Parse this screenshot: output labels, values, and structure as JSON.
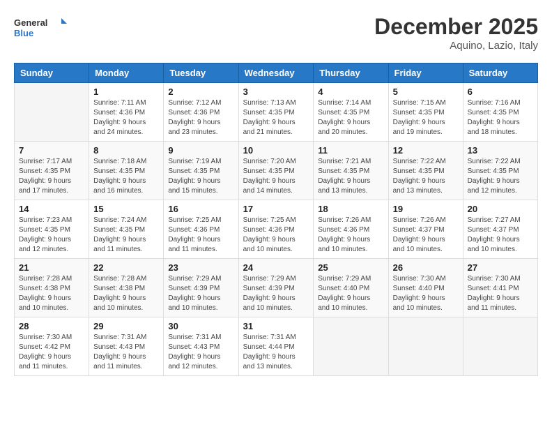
{
  "header": {
    "logo_general": "General",
    "logo_blue": "Blue",
    "month_title": "December 2025",
    "location": "Aquino, Lazio, Italy"
  },
  "days_of_week": [
    "Sunday",
    "Monday",
    "Tuesday",
    "Wednesday",
    "Thursday",
    "Friday",
    "Saturday"
  ],
  "weeks": [
    [
      {
        "day": "",
        "info": ""
      },
      {
        "day": "1",
        "info": "Sunrise: 7:11 AM\nSunset: 4:36 PM\nDaylight: 9 hours\nand 24 minutes."
      },
      {
        "day": "2",
        "info": "Sunrise: 7:12 AM\nSunset: 4:36 PM\nDaylight: 9 hours\nand 23 minutes."
      },
      {
        "day": "3",
        "info": "Sunrise: 7:13 AM\nSunset: 4:35 PM\nDaylight: 9 hours\nand 21 minutes."
      },
      {
        "day": "4",
        "info": "Sunrise: 7:14 AM\nSunset: 4:35 PM\nDaylight: 9 hours\nand 20 minutes."
      },
      {
        "day": "5",
        "info": "Sunrise: 7:15 AM\nSunset: 4:35 PM\nDaylight: 9 hours\nand 19 minutes."
      },
      {
        "day": "6",
        "info": "Sunrise: 7:16 AM\nSunset: 4:35 PM\nDaylight: 9 hours\nand 18 minutes."
      }
    ],
    [
      {
        "day": "7",
        "info": "Sunrise: 7:17 AM\nSunset: 4:35 PM\nDaylight: 9 hours\nand 17 minutes."
      },
      {
        "day": "8",
        "info": "Sunrise: 7:18 AM\nSunset: 4:35 PM\nDaylight: 9 hours\nand 16 minutes."
      },
      {
        "day": "9",
        "info": "Sunrise: 7:19 AM\nSunset: 4:35 PM\nDaylight: 9 hours\nand 15 minutes."
      },
      {
        "day": "10",
        "info": "Sunrise: 7:20 AM\nSunset: 4:35 PM\nDaylight: 9 hours\nand 14 minutes."
      },
      {
        "day": "11",
        "info": "Sunrise: 7:21 AM\nSunset: 4:35 PM\nDaylight: 9 hours\nand 13 minutes."
      },
      {
        "day": "12",
        "info": "Sunrise: 7:22 AM\nSunset: 4:35 PM\nDaylight: 9 hours\nand 13 minutes."
      },
      {
        "day": "13",
        "info": "Sunrise: 7:22 AM\nSunset: 4:35 PM\nDaylight: 9 hours\nand 12 minutes."
      }
    ],
    [
      {
        "day": "14",
        "info": "Sunrise: 7:23 AM\nSunset: 4:35 PM\nDaylight: 9 hours\nand 12 minutes."
      },
      {
        "day": "15",
        "info": "Sunrise: 7:24 AM\nSunset: 4:35 PM\nDaylight: 9 hours\nand 11 minutes."
      },
      {
        "day": "16",
        "info": "Sunrise: 7:25 AM\nSunset: 4:36 PM\nDaylight: 9 hours\nand 11 minutes."
      },
      {
        "day": "17",
        "info": "Sunrise: 7:25 AM\nSunset: 4:36 PM\nDaylight: 9 hours\nand 10 minutes."
      },
      {
        "day": "18",
        "info": "Sunrise: 7:26 AM\nSunset: 4:36 PM\nDaylight: 9 hours\nand 10 minutes."
      },
      {
        "day": "19",
        "info": "Sunrise: 7:26 AM\nSunset: 4:37 PM\nDaylight: 9 hours\nand 10 minutes."
      },
      {
        "day": "20",
        "info": "Sunrise: 7:27 AM\nSunset: 4:37 PM\nDaylight: 9 hours\nand 10 minutes."
      }
    ],
    [
      {
        "day": "21",
        "info": "Sunrise: 7:28 AM\nSunset: 4:38 PM\nDaylight: 9 hours\nand 10 minutes."
      },
      {
        "day": "22",
        "info": "Sunrise: 7:28 AM\nSunset: 4:38 PM\nDaylight: 9 hours\nand 10 minutes."
      },
      {
        "day": "23",
        "info": "Sunrise: 7:29 AM\nSunset: 4:39 PM\nDaylight: 9 hours\nand 10 minutes."
      },
      {
        "day": "24",
        "info": "Sunrise: 7:29 AM\nSunset: 4:39 PM\nDaylight: 9 hours\nand 10 minutes."
      },
      {
        "day": "25",
        "info": "Sunrise: 7:29 AM\nSunset: 4:40 PM\nDaylight: 9 hours\nand 10 minutes."
      },
      {
        "day": "26",
        "info": "Sunrise: 7:30 AM\nSunset: 4:40 PM\nDaylight: 9 hours\nand 10 minutes."
      },
      {
        "day": "27",
        "info": "Sunrise: 7:30 AM\nSunset: 4:41 PM\nDaylight: 9 hours\nand 11 minutes."
      }
    ],
    [
      {
        "day": "28",
        "info": "Sunrise: 7:30 AM\nSunset: 4:42 PM\nDaylight: 9 hours\nand 11 minutes."
      },
      {
        "day": "29",
        "info": "Sunrise: 7:31 AM\nSunset: 4:43 PM\nDaylight: 9 hours\nand 11 minutes."
      },
      {
        "day": "30",
        "info": "Sunrise: 7:31 AM\nSunset: 4:43 PM\nDaylight: 9 hours\nand 12 minutes."
      },
      {
        "day": "31",
        "info": "Sunrise: 7:31 AM\nSunset: 4:44 PM\nDaylight: 9 hours\nand 13 minutes."
      },
      {
        "day": "",
        "info": ""
      },
      {
        "day": "",
        "info": ""
      },
      {
        "day": "",
        "info": ""
      }
    ]
  ]
}
